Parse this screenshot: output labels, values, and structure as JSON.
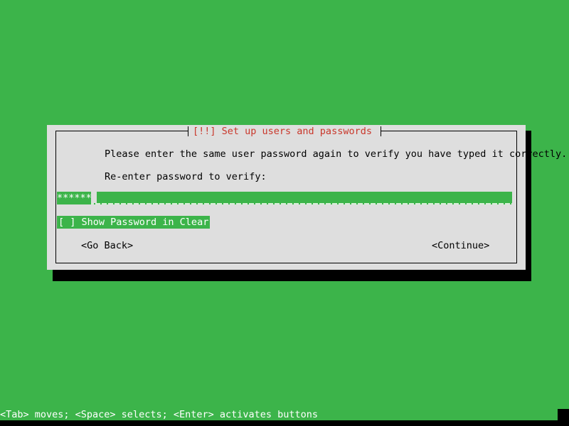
{
  "screen": {
    "background_color": "#3cb44a",
    "shadow_color": "#000000"
  },
  "dialog": {
    "title": "[!!] Set up users and passwords",
    "title_color": "#c9372b",
    "panel_color": "#dedede",
    "prompt_text": "Please enter the same user password again to verify you have typed it correctly.",
    "field_label": "Re-enter password to verify:",
    "password_input": {
      "masked_value": "******",
      "mask_char": "*",
      "char_count": 6,
      "highlight_color": "#3cb44a",
      "text_color": "#ffffff",
      "cursor_visible": true
    },
    "checkbox": {
      "label": "[ ] Show Password in Clear",
      "checked": false,
      "focused": true,
      "highlight_color": "#3cb44a"
    },
    "buttons": {
      "back_label": "<Go Back>",
      "continue_label": "<Continue>"
    }
  },
  "helpbar": {
    "text": "<Tab> moves; <Space> selects; <Enter> activates buttons",
    "text_color": "#ffffff"
  }
}
